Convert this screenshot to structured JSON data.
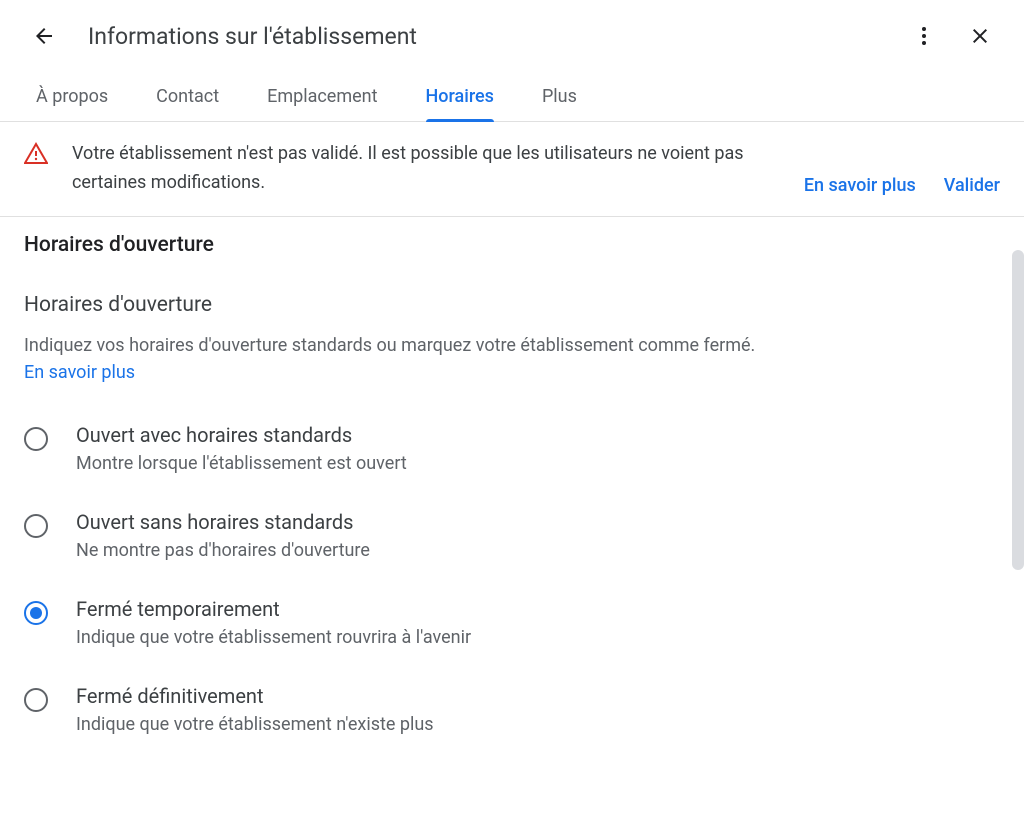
{
  "header": {
    "title": "Informations sur l'établissement"
  },
  "tabs": [
    {
      "label": "À propos",
      "active": false
    },
    {
      "label": "Contact",
      "active": false
    },
    {
      "label": "Emplacement",
      "active": false
    },
    {
      "label": "Horaires",
      "active": true
    },
    {
      "label": "Plus",
      "active": false
    }
  ],
  "alert": {
    "text": "Votre établissement n'est pas validé. Il est possible que les utilisateurs ne voient pas certaines modifications.",
    "learn_more": "En savoir plus",
    "validate": "Valider"
  },
  "section": {
    "title": "Horaires d'ouverture",
    "subsection_title": "Horaires d'ouverture",
    "description": "Indiquez vos horaires d'ouverture standards ou marquez votre établissement comme fermé.",
    "learn_more": "En savoir plus"
  },
  "options": [
    {
      "id": "open-standard",
      "label": "Ouvert avec horaires standards",
      "desc": "Montre lorsque l'établissement est ouvert",
      "selected": false
    },
    {
      "id": "open-no-hours",
      "label": "Ouvert sans horaires standards",
      "desc": "Ne montre pas d'horaires d'ouverture",
      "selected": false
    },
    {
      "id": "closed-temp",
      "label": "Fermé temporairement",
      "desc": "Indique que votre établissement rouvrira à l'avenir",
      "selected": true
    },
    {
      "id": "closed-perm",
      "label": "Fermé définitivement",
      "desc": "Indique que votre établissement n'existe plus",
      "selected": false
    }
  ]
}
